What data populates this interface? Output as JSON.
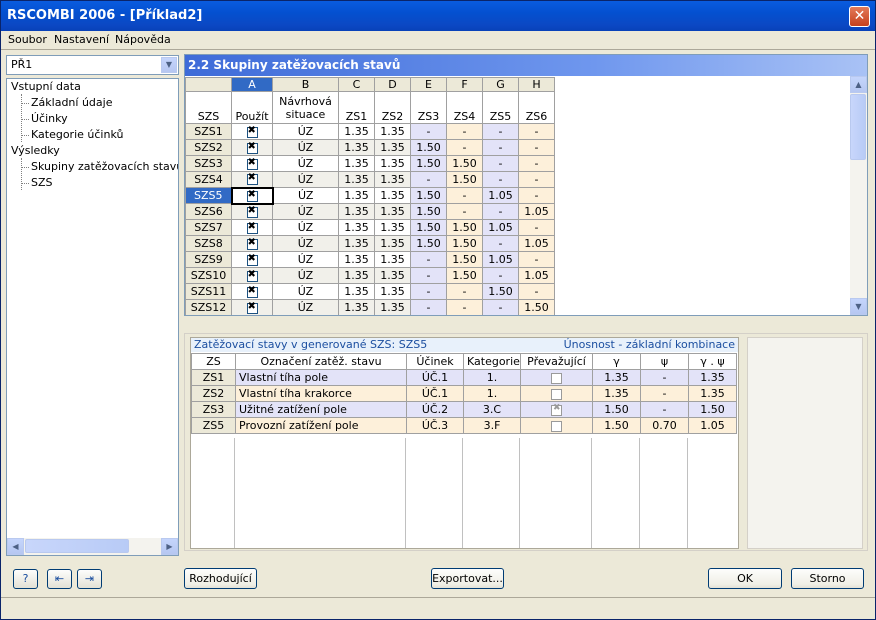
{
  "window": {
    "title": "RSCOMBI 2006 - [Příklad2]"
  },
  "menu": [
    "Soubor",
    "Nastavení",
    "Nápověda"
  ],
  "left": {
    "combo_value": "PŘ1",
    "tree": [
      {
        "label": "Vstupní data",
        "level": 0
      },
      {
        "label": "Základní údaje",
        "level": 1
      },
      {
        "label": "Účinky",
        "level": 1
      },
      {
        "label": "Kategorie účinků",
        "level": 1
      },
      {
        "label": "Výsledky",
        "level": 0
      },
      {
        "label": "Skupiny zatěžovacích stavů pc",
        "level": 1
      },
      {
        "label": "SZS",
        "level": 1
      }
    ]
  },
  "grid": {
    "title": "2.2 Skupiny zatěžovacích stavů",
    "col_letters": [
      "A",
      "B",
      "C",
      "D",
      "E",
      "F",
      "G",
      "H"
    ],
    "header": {
      "szs": "SZS",
      "pouzit": "Použít",
      "navrhova": [
        "Návrhová",
        "situace"
      ],
      "zs": [
        "ZS1",
        "ZS2",
        "ZS3",
        "ZS4",
        "ZS5",
        "ZS6"
      ]
    },
    "rows": [
      {
        "szs": "SZS1",
        "sit": "ÚZ",
        "v": [
          "1.35",
          "1.35",
          "-",
          "-",
          "-",
          "-"
        ]
      },
      {
        "szs": "SZS2",
        "sit": "ÚZ",
        "v": [
          "1.35",
          "1.35",
          "1.50",
          "-",
          "-",
          "-"
        ]
      },
      {
        "szs": "SZS3",
        "sit": "ÚZ",
        "v": [
          "1.35",
          "1.35",
          "1.50",
          "1.50",
          "-",
          "-"
        ]
      },
      {
        "szs": "SZS4",
        "sit": "ÚZ",
        "v": [
          "1.35",
          "1.35",
          "-",
          "1.50",
          "-",
          "-"
        ]
      },
      {
        "szs": "SZS5",
        "sit": "ÚZ",
        "v": [
          "1.35",
          "1.35",
          "1.50",
          "-",
          "1.05",
          "-"
        ]
      },
      {
        "szs": "SZS6",
        "sit": "ÚZ",
        "v": [
          "1.35",
          "1.35",
          "1.50",
          "-",
          "-",
          "1.05"
        ]
      },
      {
        "szs": "SZS7",
        "sit": "ÚZ",
        "v": [
          "1.35",
          "1.35",
          "1.50",
          "1.50",
          "1.05",
          "-"
        ]
      },
      {
        "szs": "SZS8",
        "sit": "ÚZ",
        "v": [
          "1.35",
          "1.35",
          "1.50",
          "1.50",
          "-",
          "1.05"
        ]
      },
      {
        "szs": "SZS9",
        "sit": "ÚZ",
        "v": [
          "1.35",
          "1.35",
          "-",
          "1.50",
          "1.05",
          "-"
        ]
      },
      {
        "szs": "SZS10",
        "sit": "ÚZ",
        "v": [
          "1.35",
          "1.35",
          "-",
          "1.50",
          "-",
          "1.05"
        ]
      },
      {
        "szs": "SZS11",
        "sit": "ÚZ",
        "v": [
          "1.35",
          "1.35",
          "-",
          "-",
          "1.50",
          "-"
        ]
      },
      {
        "szs": "SZS12",
        "sit": "ÚZ",
        "v": [
          "1.35",
          "1.35",
          "-",
          "-",
          "-",
          "1.50"
        ]
      }
    ],
    "selected_row": 4
  },
  "detail": {
    "title": "Zatěžovací stavy v generované SZS: SZS5",
    "title_right": "Únosnost - základní kombinace",
    "headers": [
      "ZS",
      "Označení zatěž. stavu",
      "Účinek",
      "Kategorie",
      "Převažující",
      "γ",
      "ψ",
      "γ . ψ"
    ],
    "rows": [
      {
        "zs": "ZS1",
        "name": "Vlastní tíha pole",
        "ucinek": "ÚČ.1",
        "kat": "1.",
        "prev": false,
        "g": "1.35",
        "psi": "-",
        "gp": "1.35",
        "color": "blue"
      },
      {
        "zs": "ZS2",
        "name": "Vlastní tíha krakorce",
        "ucinek": "ÚČ.1",
        "kat": "1.",
        "prev": false,
        "g": "1.35",
        "psi": "-",
        "gp": "1.35",
        "color": "orange"
      },
      {
        "zs": "ZS3",
        "name": "Užitné zatížení pole",
        "ucinek": "ÚČ.2",
        "kat": "3.C",
        "prev": true,
        "g": "1.50",
        "psi": "-",
        "gp": "1.50",
        "color": "blue"
      },
      {
        "zs": "ZS5",
        "name": "Provozní zatížení pole",
        "ucinek": "ÚČ.3",
        "kat": "3.F",
        "prev": false,
        "g": "1.50",
        "psi": "0.70",
        "gp": "1.05",
        "color": "orange"
      }
    ]
  },
  "buttons": {
    "rozhodujici": "Rozhodující",
    "exportovat": "Exportovat...",
    "ok": "OK",
    "storno": "Storno"
  },
  "colors": {
    "selected": "#316ac5",
    "title_bar": "#0450d0",
    "blue_col": "#e3e3f8",
    "orange_col": "#fdf0da"
  }
}
